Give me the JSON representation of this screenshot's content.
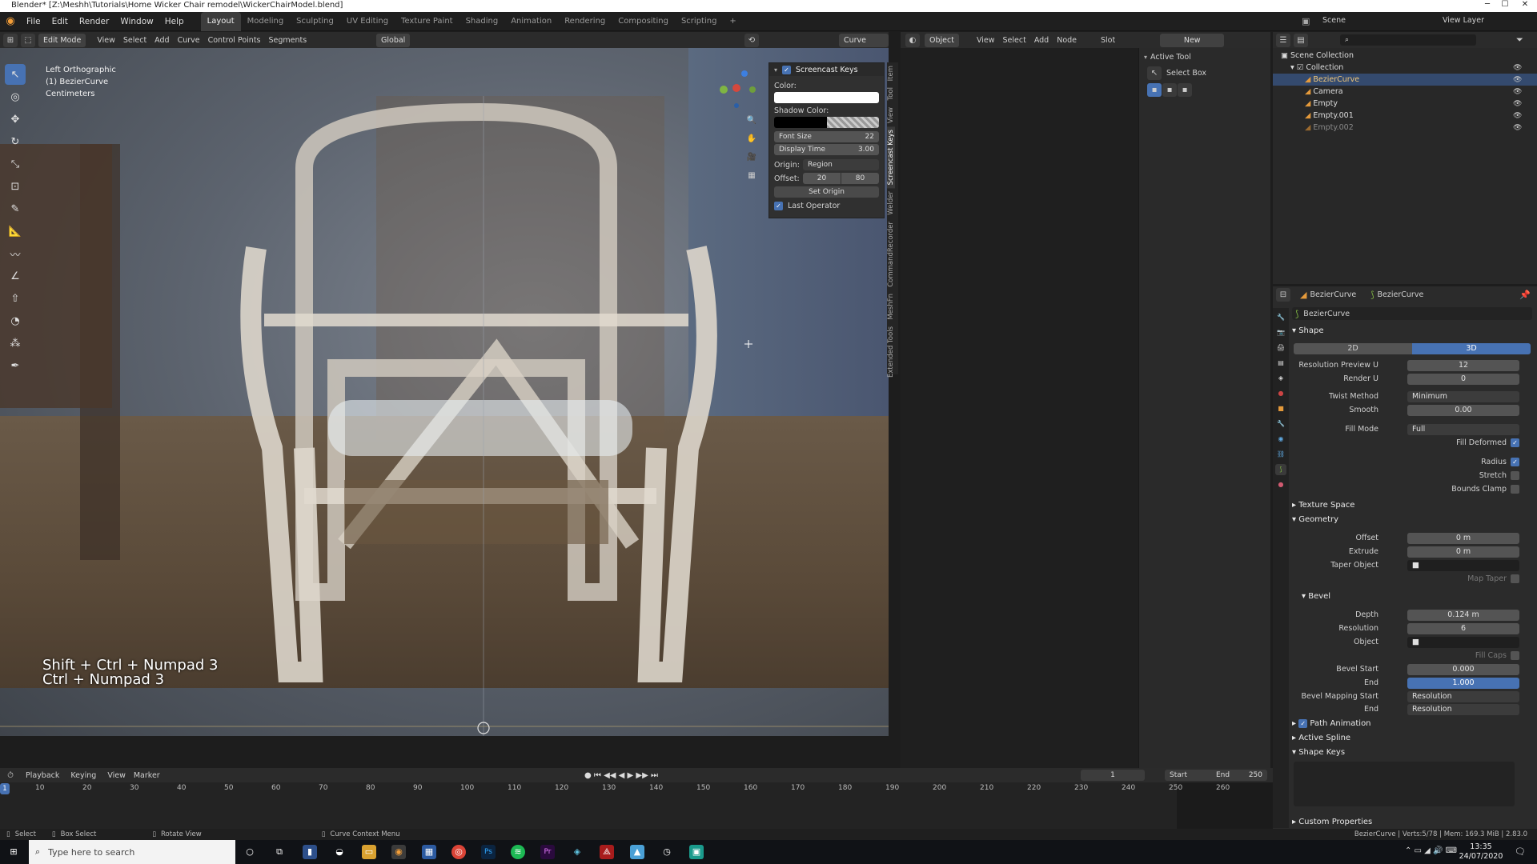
{
  "title_bar": {
    "text": "Blender* [Z:\\Meshh\\Tutorials\\Home Wicker Chair remodel\\WickerChairModel.blend]"
  },
  "menu": [
    "File",
    "Edit",
    "Render",
    "Window",
    "Help"
  ],
  "workspaces": [
    "Layout",
    "Modeling",
    "Sculpting",
    "UV Editing",
    "Texture Paint",
    "Shading",
    "Animation",
    "Rendering",
    "Compositing",
    "Scripting"
  ],
  "scene": {
    "label": "Scene",
    "view_layer": "View Layer"
  },
  "viewport_header": {
    "mode": "Edit Mode",
    "menus": [
      "View",
      "Select",
      "Add",
      "Curve",
      "Control Points",
      "Segments"
    ],
    "orientation": "Global",
    "tool": "Curve Stroke"
  },
  "viewport_overlay": {
    "view": "Left Orthographic",
    "object": "(1) BezierCurve",
    "units": "Centimeters"
  },
  "keys_overlay": {
    "line1": "Shift + Ctrl + Numpad 3",
    "line2": "Ctrl + Numpad 3"
  },
  "screencast_panel": {
    "title": "Screencast Keys",
    "color_label": "Color:",
    "shadow_label": "Shadow Color:",
    "font_size_label": "Font Size",
    "font_size": "22",
    "display_time_label": "Display Time",
    "display_time": "3.00",
    "origin_label": "Origin:",
    "origin": "Region",
    "offset_label": "Offset:",
    "offset_x": "20",
    "offset_y": "80",
    "set_origin": "Set Origin",
    "last_operator": "Last Operator"
  },
  "side_tabs": [
    "Item",
    "Tool",
    "View",
    "Screencast Keys",
    "Welder",
    "CommandRecorder",
    "MeshFn",
    "Extended Tools"
  ],
  "node_editor": {
    "type": "Object",
    "menus": [
      "View",
      "Select",
      "Add",
      "Node"
    ],
    "slot": "Slot",
    "new": "New"
  },
  "active_tool": {
    "title": "Active Tool",
    "tool": "Select Box"
  },
  "outliner": {
    "root": "Scene Collection",
    "collection": "Collection",
    "items": [
      "BezierCurve",
      "Camera",
      "Empty",
      "Empty.001",
      "Empty.002"
    ]
  },
  "properties": {
    "object": "BezierCurve",
    "data": "BezierCurve",
    "data_name": "BezierCurve",
    "shape": {
      "title": "Shape",
      "mode_2d": "2D",
      "mode_3d": "3D",
      "res_preview_label": "Resolution Preview U",
      "res_preview": "12",
      "render_u_label": "Render U",
      "render_u": "0",
      "twist_label": "Twist Method",
      "twist": "Minimum",
      "smooth_label": "Smooth",
      "smooth": "0.00",
      "fill_mode_label": "Fill Mode",
      "fill_mode": "Full",
      "fill_deformed": "Fill Deformed",
      "radius": "Radius",
      "stretch": "Stretch",
      "bounds_clamp": "Bounds Clamp"
    },
    "texture_space": "Texture Space",
    "geometry": {
      "title": "Geometry",
      "offset_label": "Offset",
      "offset": "0 m",
      "extrude_label": "Extrude",
      "extrude": "0 m",
      "taper_label": "Taper Object",
      "map_taper": "Map Taper"
    },
    "bevel": {
      "title": "Bevel",
      "depth_label": "Depth",
      "depth": "0.124 m",
      "resolution_label": "Resolution",
      "resolution": "6",
      "object_label": "Object",
      "fill_caps": "Fill Caps",
      "start_label": "Bevel Start",
      "start": "0.000",
      "end_label": "End",
      "end": "1.000",
      "map_start_label": "Bevel Mapping Start",
      "map_start": "Resolution",
      "map_end_label": "End",
      "map_end": "Resolution"
    },
    "sections": [
      "Path Animation",
      "Active Spline",
      "Shape Keys"
    ],
    "custom_properties": "Custom Properties"
  },
  "timeline": {
    "menus": [
      "Playback",
      "Keying",
      "View",
      "Marker"
    ],
    "frame": "1",
    "start_label": "Start",
    "start": "1",
    "end_label": "End",
    "end": "250",
    "ticks": [
      "10",
      "20",
      "30",
      "40",
      "50",
      "60",
      "70",
      "80",
      "90",
      "100",
      "110",
      "120",
      "130",
      "140",
      "150",
      "160",
      "170",
      "180",
      "190",
      "200",
      "210",
      "220",
      "230",
      "240",
      "250",
      "260"
    ],
    "current": "1"
  },
  "status_bar": {
    "select": "Select",
    "box_select": "Box Select",
    "rotate_view": "Rotate View",
    "context_menu": "Curve Context Menu",
    "stats": "BezierCurve | Verts:5/78 | Mem: 169.3 MiB | 2.83.0"
  },
  "taskbar": {
    "search_placeholder": "Type here to search",
    "time": "13:35",
    "date": "24/07/2020"
  }
}
